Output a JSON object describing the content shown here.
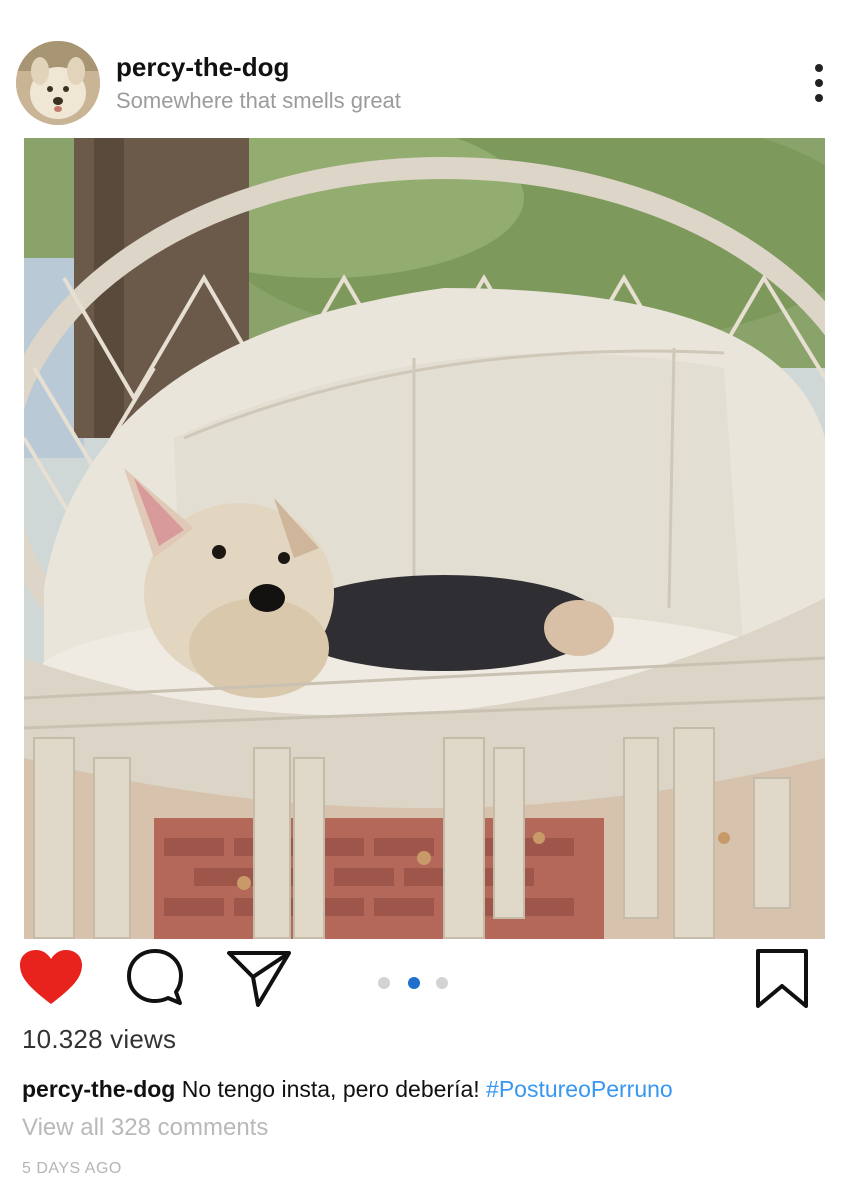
{
  "header": {
    "username": "percy-the-dog",
    "location": "Somewhere that smells great",
    "more_icon": "more-vertical-icon"
  },
  "post": {
    "image_description_icon": "dog-in-hanging-chair-photo",
    "carousel": {
      "total": 3,
      "active_index": 1
    }
  },
  "actions": {
    "like_icon": "heart-filled-icon",
    "like_color": "#e8231e",
    "comment_icon": "comment-bubble-icon",
    "share_icon": "paper-plane-icon",
    "save_icon": "bookmark-icon"
  },
  "stats": {
    "views": "10.328 views"
  },
  "caption": {
    "username": "percy-the-dog",
    "text": " No tengo insta, pero debería! ",
    "hashtag": "#PostureoPerruno",
    "hashtag_color": "#3897f0"
  },
  "comments": {
    "label": "View all 328 comments"
  },
  "timestamp": "5 DAYS AGO"
}
